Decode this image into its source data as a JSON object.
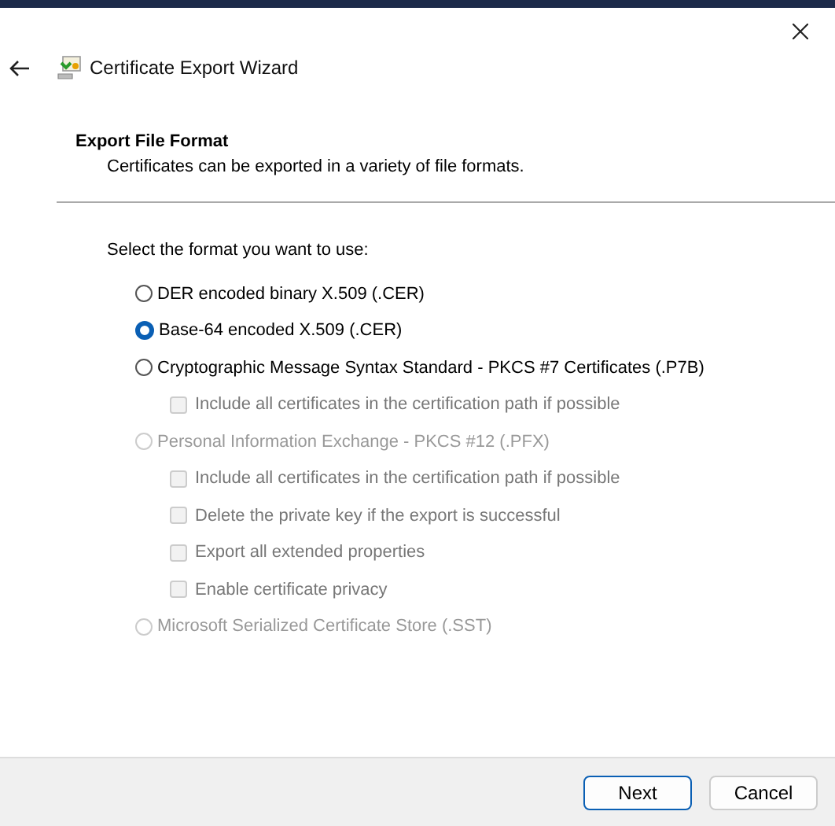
{
  "window": {
    "title": "Certificate Export Wizard"
  },
  "section": {
    "title": "Export File Format",
    "description": "Certificates can be exported in a variety of file formats."
  },
  "prompt": "Select the format you want to use:",
  "formats": [
    {
      "label": "DER encoded binary X.509 (.CER)",
      "selected": false,
      "disabled": false
    },
    {
      "label": "Base-64 encoded X.509 (.CER)",
      "selected": true,
      "disabled": false
    },
    {
      "label": "Cryptographic Message Syntax Standard - PKCS #7 Certificates (.P7B)",
      "selected": false,
      "disabled": false,
      "children": [
        {
          "label": "Include all certificates in the certification path if possible",
          "checked": false,
          "disabled": true
        }
      ]
    },
    {
      "label": "Personal Information Exchange - PKCS #12 (.PFX)",
      "selected": false,
      "disabled": true,
      "children": [
        {
          "label": "Include all certificates in the certification path if possible",
          "checked": false,
          "disabled": true
        },
        {
          "label": "Delete the private key if the export is successful",
          "checked": false,
          "disabled": true
        },
        {
          "label": "Export all extended properties",
          "checked": false,
          "disabled": true
        },
        {
          "label": "Enable certificate privacy",
          "checked": false,
          "disabled": true
        }
      ]
    },
    {
      "label": "Microsoft Serialized Certificate Store (.SST)",
      "selected": false,
      "disabled": true
    }
  ],
  "buttons": [
    {
      "label": "Next",
      "default": true
    },
    {
      "label": "Cancel",
      "default": false
    }
  ]
}
